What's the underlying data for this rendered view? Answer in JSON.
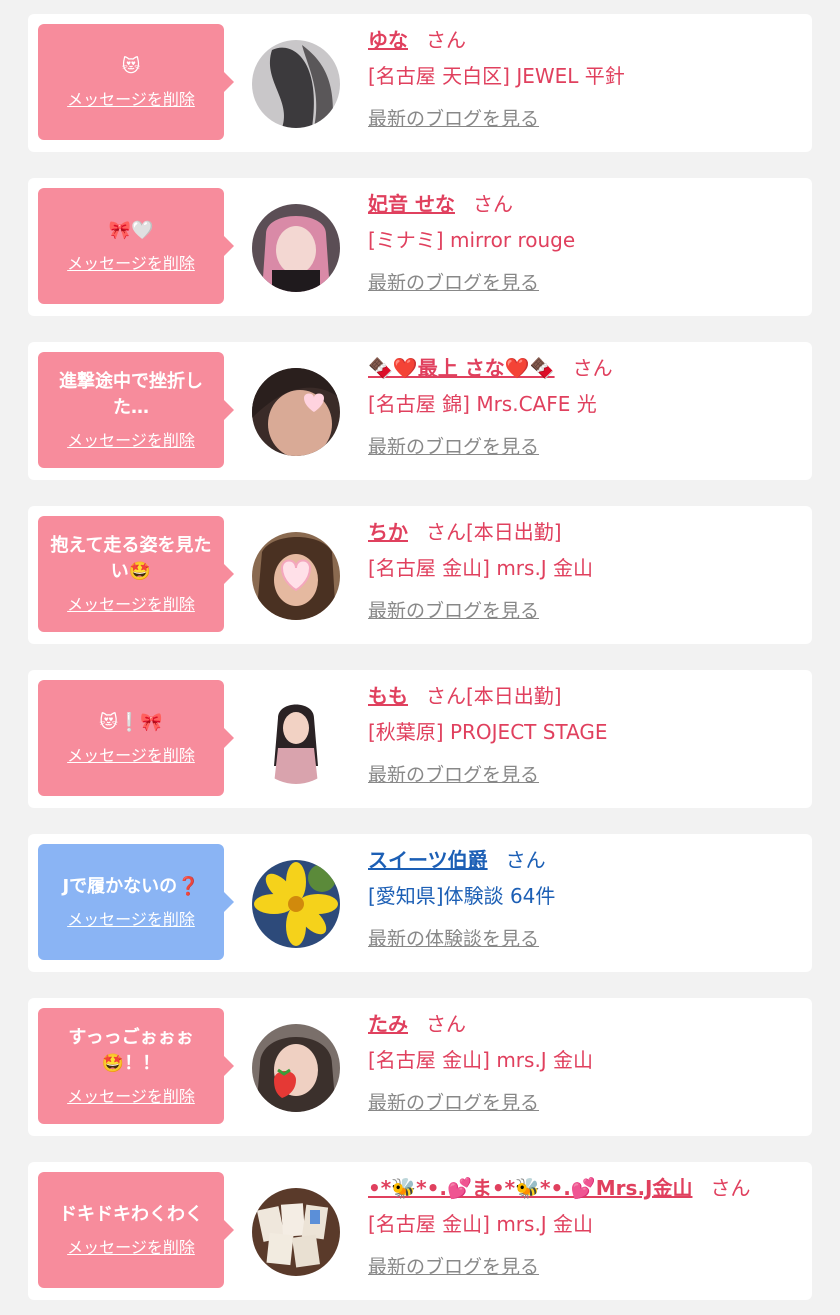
{
  "colors": {
    "bubble_pink": "#f78c9c",
    "bubble_blue": "#8ab4f4",
    "name_pink": "#e0405e",
    "name_blue": "#1c5fb5",
    "link_gray": "#888888"
  },
  "delete_label": "メッセージを削除",
  "items": [
    {
      "message": "😻",
      "name": "ゆな",
      "san": "さん",
      "shop": "[名古屋 天白区] JEWEL 平針",
      "blog": "最新のブログを見る",
      "theme": "pink",
      "avatar": "dark-hair-photo"
    },
    {
      "message": "🎀🤍",
      "name": "妃音 せな",
      "san": "さん",
      "shop": "[ミナミ] mirror rouge",
      "blog": "最新のブログを見る",
      "theme": "pink",
      "avatar": "pink-hair-photo"
    },
    {
      "message": "進撃途中で挫折した…",
      "name": "🍫❤️最上 さな❤️🍫",
      "san": "さん",
      "shop": "[名古屋 錦] Mrs.CAFE 光",
      "blog": "最新のブログを見る",
      "theme": "pink",
      "avatar": "heart-sticker-photo"
    },
    {
      "message": "抱えて走る姿を見たい🤩",
      "name": "ちか",
      "san": "さん[本日出勤]",
      "shop": "[名古屋 金山] mrs.J 金山",
      "blog": "最新のブログを見る",
      "theme": "pink",
      "avatar": "heart-c-photo"
    },
    {
      "message": "😻❕🎀",
      "name": "もも",
      "san": "さん[本日出勤]",
      "shop": "[秋葉原] PROJECT STAGE",
      "blog": "最新のブログを見る",
      "theme": "pink",
      "avatar": "cutout-girl-photo"
    },
    {
      "message": "Jで履かないの❓",
      "name": "スイーツ伯爵",
      "san": "さん",
      "shop": "[愛知県]体験談 64件",
      "blog": "最新の体験談を見る",
      "theme": "blue",
      "avatar": "yellow-flower-photo"
    },
    {
      "message": "すっっごぉぉぉ🤩！！",
      "name": "たみ",
      "san": "さん",
      "shop": "[名古屋 金山] mrs.J 金山",
      "blog": "最新のブログを見る",
      "theme": "pink",
      "avatar": "strawberry-sticker-photo"
    },
    {
      "message": "ドキドキわくわく",
      "name": "•*🐝*•.💕ま•*🐝*•.💕Mrs.J金山",
      "san": "さん",
      "shop": "[名古屋 金山] mrs.J 金山",
      "blog": "最新のブログを見る",
      "theme": "pink",
      "avatar": "cards-photo"
    }
  ]
}
